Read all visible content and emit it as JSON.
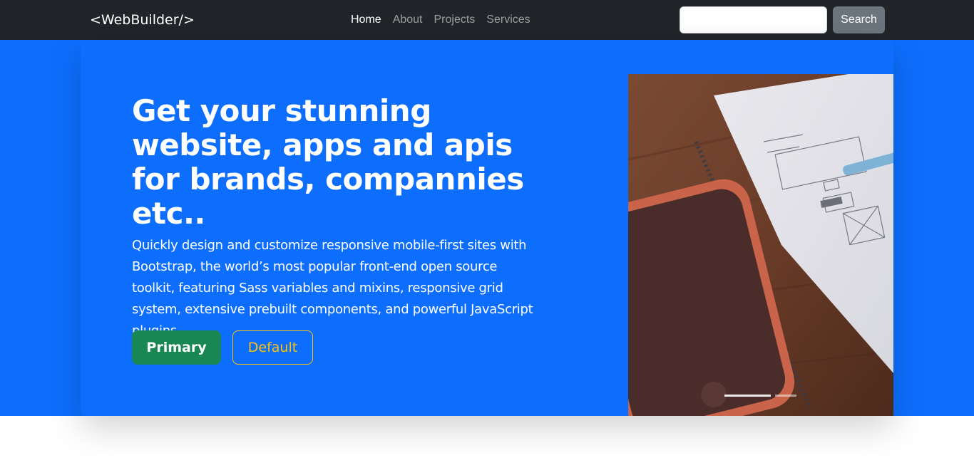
{
  "navbar": {
    "brand": "<WebBuilder/>",
    "links": [
      {
        "label": "Home",
        "active": true
      },
      {
        "label": "About",
        "active": false
      },
      {
        "label": "Projects",
        "active": false
      },
      {
        "label": "Services",
        "active": false
      }
    ],
    "search_placeholder": "",
    "search_value": "",
    "search_button_label": "Search"
  },
  "hero": {
    "headline": "Get your stunning website, apps and apis for brands, compannies etc..",
    "lead": "Quickly design and customize responsive mobile-first sites with Bootstrap, the world’s most popular front-end open source toolkit, featuring Sass variables and mixins, responsive grid system, extensive prebuilt components, and powerful JavaScript plugins.",
    "primary_button": "Primary",
    "default_button": "Default",
    "image_icon": "notebook-and-phone-photo",
    "carousel_active_index": 0
  },
  "colors": {
    "navbar_bg": "#212529",
    "hero_bg": "#0d6efd",
    "primary_btn": "#198754",
    "default_btn_outline": "#ffc107",
    "search_btn": "#6c757d"
  }
}
